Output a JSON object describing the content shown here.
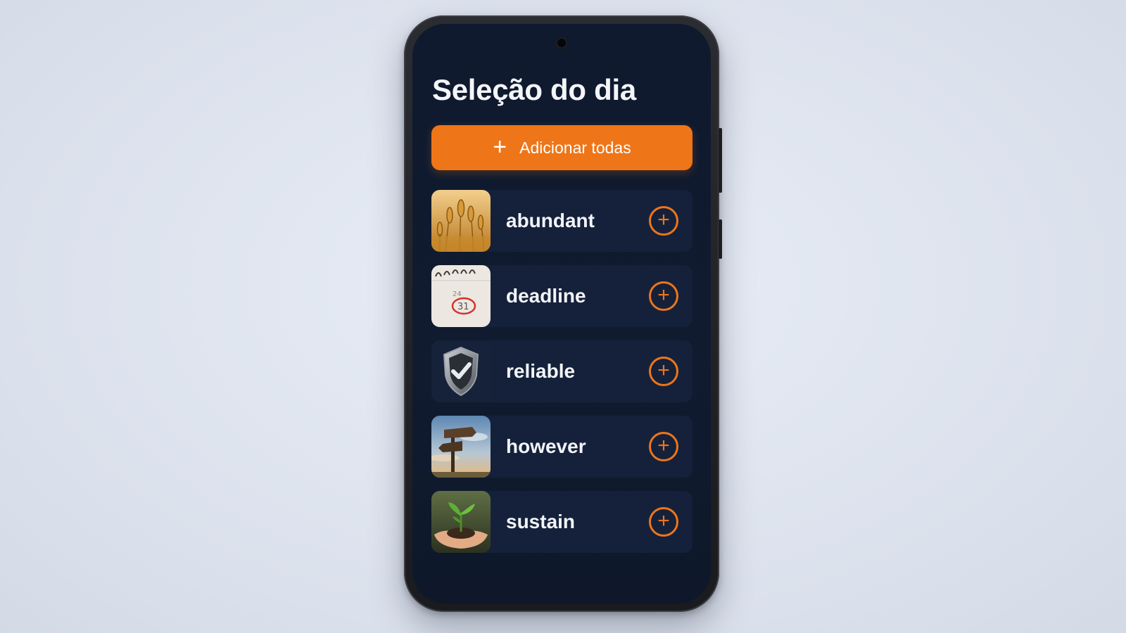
{
  "screen": {
    "title": "Seleção do dia",
    "add_all_icon": "+",
    "add_all_label": "Adicionar todas"
  },
  "words": [
    {
      "word": "abundant",
      "image": "wheat-icon",
      "add_icon": "+"
    },
    {
      "word": "deadline",
      "image": "calendar-icon",
      "add_icon": "+",
      "calendar_number": "31"
    },
    {
      "word": "reliable",
      "image": "shield-check-icon",
      "add_icon": "+"
    },
    {
      "word": "however",
      "image": "signpost-icon",
      "add_icon": "+"
    },
    {
      "word": "sustain",
      "image": "sprout-in-hands-icon",
      "add_icon": "+"
    }
  ],
  "colors": {
    "accent": "#ee7518",
    "background": "#0f1a2e",
    "card": "#15213a",
    "text": "#f2f4f8"
  }
}
